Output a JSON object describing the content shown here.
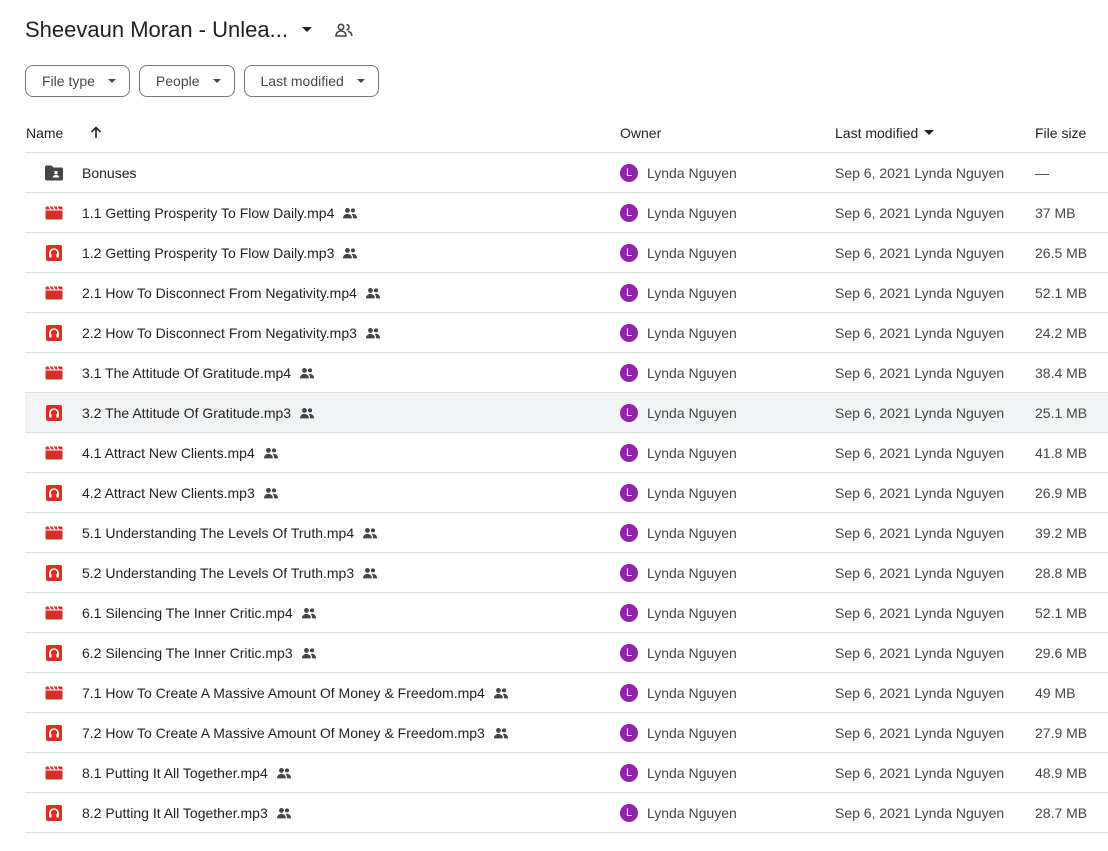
{
  "header": {
    "title": "Sheevaun Moran - Unlea...",
    "title_caret_icon": "caret-down-icon",
    "shared_icon": "people-icon"
  },
  "filters": [
    {
      "label": "File type"
    },
    {
      "label": "People"
    },
    {
      "label": "Last modified"
    }
  ],
  "columns": {
    "name": "Name",
    "owner": "Owner",
    "last_modified": "Last modified",
    "file_size": "File size"
  },
  "colors": {
    "folder": "#444746",
    "video": "#d93025",
    "audio": "#d93025",
    "avatar": "#8e24aa"
  },
  "rows": [
    {
      "type": "folder",
      "name": "Bonuses",
      "shared": false,
      "owner_initial": "L",
      "owner": "Lynda Nguyen",
      "modified": "Sep 6, 2021 Lynda Nguyen",
      "size": "—"
    },
    {
      "type": "video",
      "name": "1.1 Getting Prosperity To Flow Daily.mp4",
      "shared": true,
      "owner_initial": "L",
      "owner": "Lynda Nguyen",
      "modified": "Sep 6, 2021 Lynda Nguyen",
      "size": "37 MB"
    },
    {
      "type": "audio",
      "name": "1.2 Getting Prosperity To Flow Daily.mp3",
      "shared": true,
      "owner_initial": "L",
      "owner": "Lynda Nguyen",
      "modified": "Sep 6, 2021 Lynda Nguyen",
      "size": "26.5 MB"
    },
    {
      "type": "video",
      "name": "2.1 How To Disconnect From Negativity.mp4",
      "shared": true,
      "owner_initial": "L",
      "owner": "Lynda Nguyen",
      "modified": "Sep 6, 2021 Lynda Nguyen",
      "size": "52.1 MB"
    },
    {
      "type": "audio",
      "name": "2.2 How To Disconnect From Negativity.mp3",
      "shared": true,
      "owner_initial": "L",
      "owner": "Lynda Nguyen",
      "modified": "Sep 6, 2021 Lynda Nguyen",
      "size": "24.2 MB"
    },
    {
      "type": "video",
      "name": "3.1 The Attitude Of Gratitude.mp4",
      "shared": true,
      "owner_initial": "L",
      "owner": "Lynda Nguyen",
      "modified": "Sep 6, 2021 Lynda Nguyen",
      "size": "38.4 MB"
    },
    {
      "type": "audio",
      "name": "3.2 The Attitude Of Gratitude.mp3",
      "shared": true,
      "owner_initial": "L",
      "owner": "Lynda Nguyen",
      "modified": "Sep 6, 2021 Lynda Nguyen",
      "size": "25.1 MB",
      "hover": true
    },
    {
      "type": "video",
      "name": "4.1 Attract New Clients.mp4",
      "shared": true,
      "owner_initial": "L",
      "owner": "Lynda Nguyen",
      "modified": "Sep 6, 2021 Lynda Nguyen",
      "size": "41.8 MB"
    },
    {
      "type": "audio",
      "name": "4.2 Attract New Clients.mp3",
      "shared": true,
      "owner_initial": "L",
      "owner": "Lynda Nguyen",
      "modified": "Sep 6, 2021 Lynda Nguyen",
      "size": "26.9 MB"
    },
    {
      "type": "video",
      "name": "5.1 Understanding The Levels Of Truth.mp4",
      "shared": true,
      "owner_initial": "L",
      "owner": "Lynda Nguyen",
      "modified": "Sep 6, 2021 Lynda Nguyen",
      "size": "39.2 MB"
    },
    {
      "type": "audio",
      "name": "5.2 Understanding The Levels Of Truth.mp3",
      "shared": true,
      "owner_initial": "L",
      "owner": "Lynda Nguyen",
      "modified": "Sep 6, 2021 Lynda Nguyen",
      "size": "28.8 MB"
    },
    {
      "type": "video",
      "name": "6.1 Silencing The Inner Critic.mp4",
      "shared": true,
      "owner_initial": "L",
      "owner": "Lynda Nguyen",
      "modified": "Sep 6, 2021 Lynda Nguyen",
      "size": "52.1 MB"
    },
    {
      "type": "audio",
      "name": "6.2 Silencing The Inner Critic.mp3",
      "shared": true,
      "owner_initial": "L",
      "owner": "Lynda Nguyen",
      "modified": "Sep 6, 2021 Lynda Nguyen",
      "size": "29.6 MB"
    },
    {
      "type": "video",
      "name": "7.1 How To Create A Massive Amount Of Money & Freedom.mp4",
      "shared": true,
      "owner_initial": "L",
      "owner": "Lynda Nguyen",
      "modified": "Sep 6, 2021 Lynda Nguyen",
      "size": "49 MB"
    },
    {
      "type": "audio",
      "name": "7.2 How To Create A Massive Amount Of Money & Freedom.mp3",
      "shared": true,
      "owner_initial": "L",
      "owner": "Lynda Nguyen",
      "modified": "Sep 6, 2021 Lynda Nguyen",
      "size": "27.9 MB"
    },
    {
      "type": "video",
      "name": "8.1 Putting It All Together.mp4",
      "shared": true,
      "owner_initial": "L",
      "owner": "Lynda Nguyen",
      "modified": "Sep 6, 2021 Lynda Nguyen",
      "size": "48.9 MB"
    },
    {
      "type": "audio",
      "name": "8.2 Putting It All Together.mp3",
      "shared": true,
      "owner_initial": "L",
      "owner": "Lynda Nguyen",
      "modified": "Sep 6, 2021 Lynda Nguyen",
      "size": "28.7 MB"
    }
  ]
}
